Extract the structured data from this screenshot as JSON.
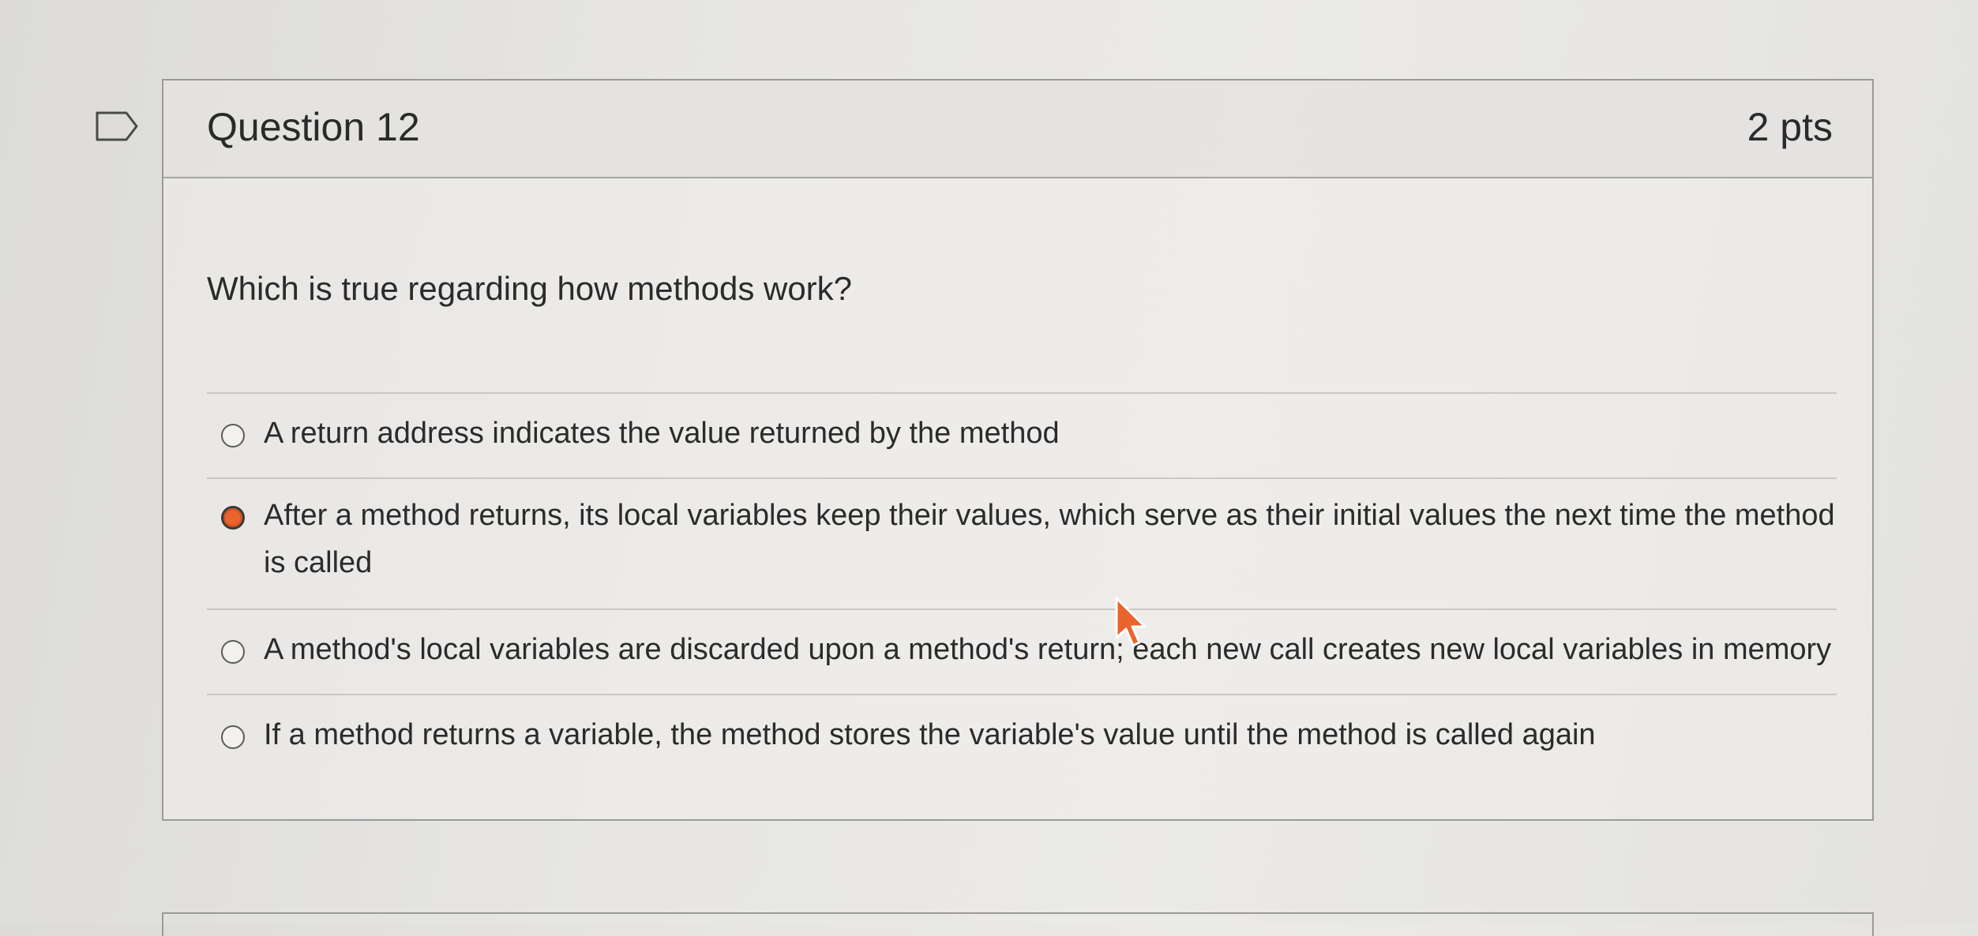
{
  "question": {
    "title": "Question 12",
    "points": "2 pts",
    "text": "Which is true regarding how methods work?",
    "flag_icon": "flag-outline-icon"
  },
  "answers": [
    {
      "label": "A return address indicates the value returned by the method",
      "selected": false
    },
    {
      "label": "After a method returns, its local variables keep their values, which serve as their initial values the next time the method is called",
      "selected": true
    },
    {
      "label": "A method's local variables are discarded upon a method's return; each new call creates new local variables in memory",
      "selected": false
    },
    {
      "label": "If a method returns a variable, the method stores the variable's value until the method is called again",
      "selected": false
    }
  ],
  "colors": {
    "selected_radio": "#e9632d",
    "border": "#9a9a9a",
    "text": "#2b2b2b"
  }
}
